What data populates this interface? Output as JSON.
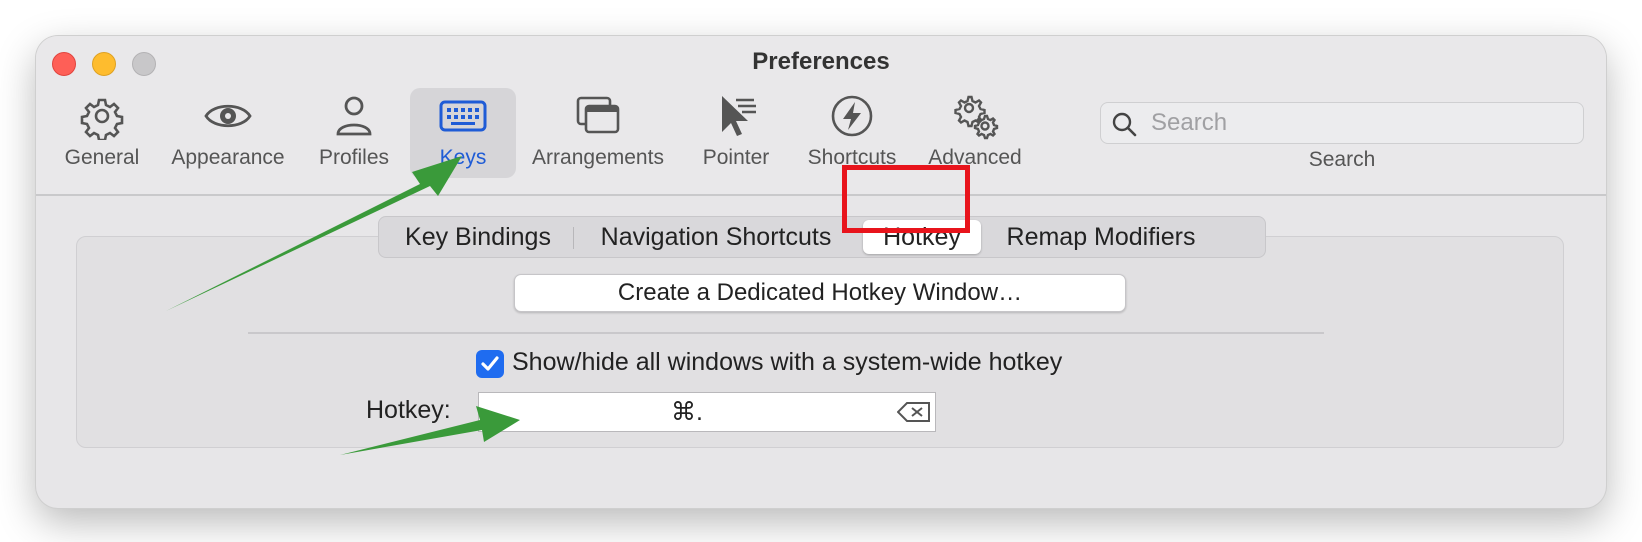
{
  "window": {
    "title": "Preferences"
  },
  "toolbar": {
    "items": [
      {
        "label": "General",
        "icon": "gear-icon"
      },
      {
        "label": "Appearance",
        "icon": "eye-icon"
      },
      {
        "label": "Profiles",
        "icon": "person-icon"
      },
      {
        "label": "Keys",
        "icon": "keyboard-icon",
        "selected": true
      },
      {
        "label": "Arrangements",
        "icon": "windows-icon"
      },
      {
        "label": "Pointer",
        "icon": "pointer-icon"
      },
      {
        "label": "Shortcuts",
        "icon": "bolt-icon"
      },
      {
        "label": "Advanced",
        "icon": "gears-icon"
      }
    ],
    "search": {
      "placeholder": "Search",
      "label": "Search"
    }
  },
  "tabs": {
    "items": [
      "Key Bindings",
      "Navigation Shortcuts",
      "Hotkey",
      "Remap Modifiers"
    ],
    "active": "Hotkey"
  },
  "hotkey_pane": {
    "create_button": "Create a Dedicated Hotkey Window…",
    "checkbox_label": "Show/hide all windows with a system-wide hotkey",
    "checkbox_checked": true,
    "hotkey_label": "Hotkey:",
    "hotkey_value": "⌘."
  },
  "colors": {
    "accent": "#1f6cf0",
    "selected_label": "#1f5cd6",
    "highlight_box": "#e8141c",
    "arrow": "#3a9a3a"
  }
}
